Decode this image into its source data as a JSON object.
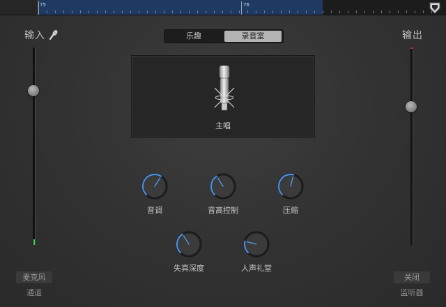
{
  "ruler": {
    "bar_start": "75",
    "bar_next": "76"
  },
  "input": {
    "title": "输入",
    "button": "麦克风",
    "caption": "通道",
    "volume": 0.78,
    "level": 0.03
  },
  "output": {
    "title": "输出",
    "button": "关闭",
    "caption": "监听器",
    "volume": 0.7
  },
  "mode_tabs": {
    "fun": "乐趣",
    "studio": "录音室",
    "selected": "录音室"
  },
  "preset": {
    "name": "主唱",
    "icon": "studio-condenser-mic-icon"
  },
  "knobs": [
    {
      "id": "pitch",
      "label": "音调",
      "value": 0.62
    },
    {
      "id": "pitch-control",
      "label": "音高控制",
      "value": 0.38
    },
    {
      "id": "compression",
      "label": "压缩",
      "value": 0.55
    },
    {
      "id": "distortion",
      "label": "失真深度",
      "value": 0.38
    },
    {
      "id": "reverb",
      "label": "人声礼堂",
      "value": 0.22
    }
  ],
  "colors": {
    "accent": "#4a90e2",
    "level_green": "#3fd24e",
    "region_blue": "#1e3a63"
  }
}
